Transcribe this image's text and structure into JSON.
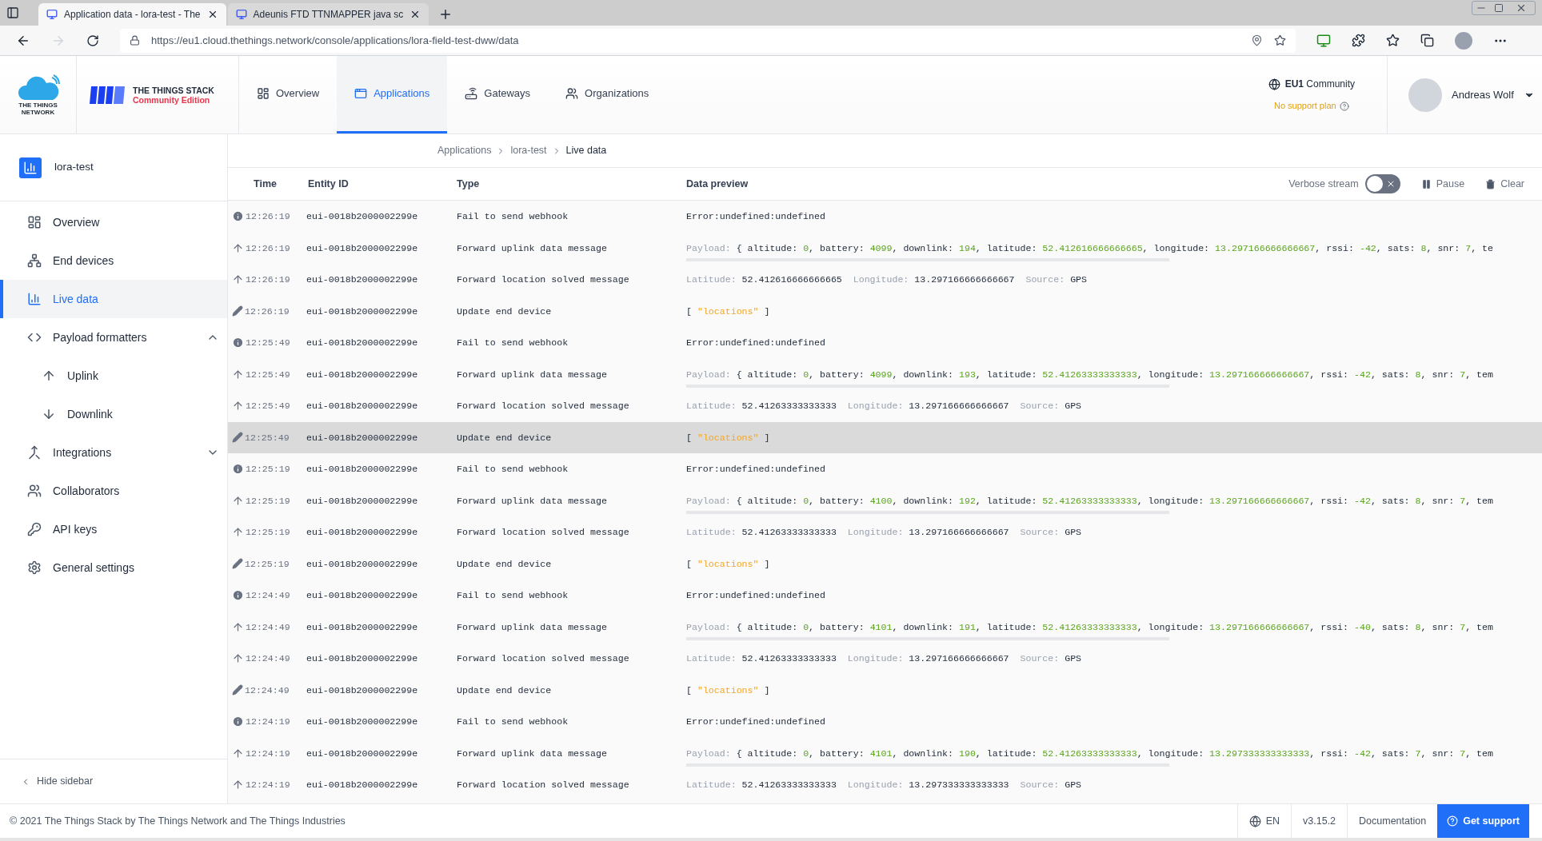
{
  "browser": {
    "tabs": [
      {
        "title": "Application data - lora-test - The",
        "selected": true
      },
      {
        "title": "Adeunis FTD TTNMAPPER java sc",
        "selected": false
      }
    ],
    "url": "https://eu1.cloud.thethings.network/console/applications/lora-field-test-dww/data"
  },
  "header": {
    "logo_lines": [
      "THE THINGS",
      "NETWORK"
    ],
    "product": "THE THINGS STACK",
    "edition": "Community Edition",
    "nav": [
      {
        "label": "Overview",
        "selected": false
      },
      {
        "label": "Applications",
        "selected": true
      },
      {
        "label": "Gateways",
        "selected": false
      },
      {
        "label": "Organizations",
        "selected": false
      }
    ],
    "cluster": "EU1",
    "cluster_suffix": "Community",
    "support": "No support plan",
    "user": "Andreas Wolf"
  },
  "sidebar": {
    "app": "lora-test",
    "items": [
      {
        "label": "Overview",
        "selected": false
      },
      {
        "label": "End devices",
        "selected": false
      },
      {
        "label": "Live data",
        "selected": true
      },
      {
        "label": "Payload formatters",
        "selected": false,
        "expanded": true,
        "children": [
          {
            "label": "Uplink",
            "selected": false
          },
          {
            "label": "Downlink",
            "selected": false
          }
        ]
      },
      {
        "label": "Integrations",
        "selected": false,
        "expanded": false
      },
      {
        "label": "Collaborators",
        "selected": false
      },
      {
        "label": "API keys",
        "selected": false
      },
      {
        "label": "General settings",
        "selected": false
      }
    ],
    "hide": "Hide sidebar"
  },
  "breadcrumb": [
    "Applications",
    "lora-test",
    "Live data"
  ],
  "table": {
    "columns": [
      "Time",
      "Entity ID",
      "Type",
      "Data preview"
    ],
    "verbose_label": "Verbose stream",
    "verbose_on": false,
    "pause": "Pause",
    "clear": "Clear",
    "rows": [
      {
        "kind": "webhook",
        "time": "12:26:19",
        "entity": "eui-0018b2000002299e",
        "type": "Fail to send webhook",
        "highlighted": false,
        "preview": "Error:undefined:undefined"
      },
      {
        "kind": "uplink",
        "time": "12:26:19",
        "entity": "eui-0018b2000002299e",
        "type": "Forward uplink data message",
        "highlighted": false,
        "label": "Payload:",
        "pairs": [
          [
            "{ altitude: ",
            "0"
          ],
          [
            ", battery: ",
            "4099"
          ],
          [
            ", downlink: ",
            "194"
          ],
          [
            ", latitude: ",
            "52.412616666666665"
          ],
          [
            ", longitude: ",
            "13.297166666666667"
          ],
          [
            ", rssi: ",
            "-42"
          ],
          [
            ", sats: ",
            "8"
          ],
          [
            ", snr: ",
            "7"
          ]
        ],
        "tail": ", te"
      },
      {
        "kind": "location",
        "time": "12:26:19",
        "entity": "eui-0018b2000002299e",
        "type": "Forward location solved message",
        "highlighted": false,
        "pairs": [
          [
            "Latitude:",
            "52.412616666666665"
          ],
          [
            "Longitude:",
            "13.297166666666667"
          ],
          [
            "Source:",
            "GPS"
          ]
        ]
      },
      {
        "kind": "update",
        "time": "12:26:19",
        "entity": "eui-0018b2000002299e",
        "type": "Update end device",
        "highlighted": false,
        "open": "[",
        "value": "\"locations\"",
        "close": "]"
      },
      {
        "kind": "webhook",
        "time": "12:25:49",
        "entity": "eui-0018b2000002299e",
        "type": "Fail to send webhook",
        "highlighted": false,
        "preview": "Error:undefined:undefined"
      },
      {
        "kind": "uplink",
        "time": "12:25:49",
        "entity": "eui-0018b2000002299e",
        "type": "Forward uplink data message",
        "highlighted": false,
        "label": "Payload:",
        "pairs": [
          [
            "{ altitude: ",
            "0"
          ],
          [
            ", battery: ",
            "4099"
          ],
          [
            ", downlink: ",
            "193"
          ],
          [
            ", latitude: ",
            "52.41263333333333"
          ],
          [
            ", longitude: ",
            "13.297166666666667"
          ],
          [
            ", rssi: ",
            "-42"
          ],
          [
            ", sats: ",
            "8"
          ],
          [
            ", snr: ",
            "7"
          ]
        ],
        "tail": ", tem"
      },
      {
        "kind": "location",
        "time": "12:25:49",
        "entity": "eui-0018b2000002299e",
        "type": "Forward location solved message",
        "highlighted": false,
        "pairs": [
          [
            "Latitude:",
            "52.41263333333333"
          ],
          [
            "Longitude:",
            "13.297166666666667"
          ],
          [
            "Source:",
            "GPS"
          ]
        ]
      },
      {
        "kind": "update",
        "time": "12:25:49",
        "entity": "eui-0018b2000002299e",
        "type": "Update end device",
        "highlighted": true,
        "open": "[",
        "value": "\"locations\"",
        "close": "]"
      },
      {
        "kind": "webhook",
        "time": "12:25:19",
        "entity": "eui-0018b2000002299e",
        "type": "Fail to send webhook",
        "highlighted": false,
        "preview": "Error:undefined:undefined"
      },
      {
        "kind": "uplink",
        "time": "12:25:19",
        "entity": "eui-0018b2000002299e",
        "type": "Forward uplink data message",
        "highlighted": false,
        "label": "Payload:",
        "pairs": [
          [
            "{ altitude: ",
            "0"
          ],
          [
            ", battery: ",
            "4100"
          ],
          [
            ", downlink: ",
            "192"
          ],
          [
            ", latitude: ",
            "52.41263333333333"
          ],
          [
            ", longitude: ",
            "13.297166666666667"
          ],
          [
            ", rssi: ",
            "-42"
          ],
          [
            ", sats: ",
            "8"
          ],
          [
            ", snr: ",
            "7"
          ]
        ],
        "tail": ", tem"
      },
      {
        "kind": "location",
        "time": "12:25:19",
        "entity": "eui-0018b2000002299e",
        "type": "Forward location solved message",
        "highlighted": false,
        "pairs": [
          [
            "Latitude:",
            "52.41263333333333"
          ],
          [
            "Longitude:",
            "13.297166666666667"
          ],
          [
            "Source:",
            "GPS"
          ]
        ]
      },
      {
        "kind": "update",
        "time": "12:25:19",
        "entity": "eui-0018b2000002299e",
        "type": "Update end device",
        "highlighted": false,
        "open": "[",
        "value": "\"locations\"",
        "close": "]"
      },
      {
        "kind": "webhook",
        "time": "12:24:49",
        "entity": "eui-0018b2000002299e",
        "type": "Fail to send webhook",
        "highlighted": false,
        "preview": "Error:undefined:undefined"
      },
      {
        "kind": "uplink",
        "time": "12:24:49",
        "entity": "eui-0018b2000002299e",
        "type": "Forward uplink data message",
        "highlighted": false,
        "label": "Payload:",
        "pairs": [
          [
            "{ altitude: ",
            "0"
          ],
          [
            ", battery: ",
            "4101"
          ],
          [
            ", downlink: ",
            "191"
          ],
          [
            ", latitude: ",
            "52.41263333333333"
          ],
          [
            ", longitude: ",
            "13.297166666666667"
          ],
          [
            ", rssi: ",
            "-40"
          ],
          [
            ", sats: ",
            "8"
          ],
          [
            ", snr: ",
            "7"
          ]
        ],
        "tail": ", tem"
      },
      {
        "kind": "location",
        "time": "12:24:49",
        "entity": "eui-0018b2000002299e",
        "type": "Forward location solved message",
        "highlighted": false,
        "pairs": [
          [
            "Latitude:",
            "52.41263333333333"
          ],
          [
            "Longitude:",
            "13.297166666666667"
          ],
          [
            "Source:",
            "GPS"
          ]
        ]
      },
      {
        "kind": "update",
        "time": "12:24:49",
        "entity": "eui-0018b2000002299e",
        "type": "Update end device",
        "highlighted": false,
        "open": "[",
        "value": "\"locations\"",
        "close": "]"
      },
      {
        "kind": "webhook",
        "time": "12:24:19",
        "entity": "eui-0018b2000002299e",
        "type": "Fail to send webhook",
        "highlighted": false,
        "preview": "Error:undefined:undefined"
      },
      {
        "kind": "uplink",
        "time": "12:24:19",
        "entity": "eui-0018b2000002299e",
        "type": "Forward uplink data message",
        "highlighted": false,
        "label": "Payload:",
        "pairs": [
          [
            "{ altitude: ",
            "0"
          ],
          [
            ", battery: ",
            "4101"
          ],
          [
            ", downlink: ",
            "190"
          ],
          [
            ", latitude: ",
            "52.41263333333333"
          ],
          [
            ", longitude: ",
            "13.297333333333333"
          ],
          [
            ", rssi: ",
            "-42"
          ],
          [
            ", sats: ",
            "7"
          ],
          [
            ", snr: ",
            "7"
          ]
        ],
        "tail": ", tem"
      },
      {
        "kind": "location",
        "time": "12:24:19",
        "entity": "eui-0018b2000002299e",
        "type": "Forward location solved message",
        "highlighted": false,
        "pairs": [
          [
            "Latitude:",
            "52.41263333333333"
          ],
          [
            "Longitude:",
            "13.297333333333333"
          ],
          [
            "Source:",
            "GPS"
          ]
        ]
      }
    ]
  },
  "footer": {
    "copyright": "© 2021 The Things Stack by The Things Network and The Things Industries",
    "language": "EN",
    "version": "v3.15.2",
    "docs": "Documentation",
    "support": "Get support"
  }
}
